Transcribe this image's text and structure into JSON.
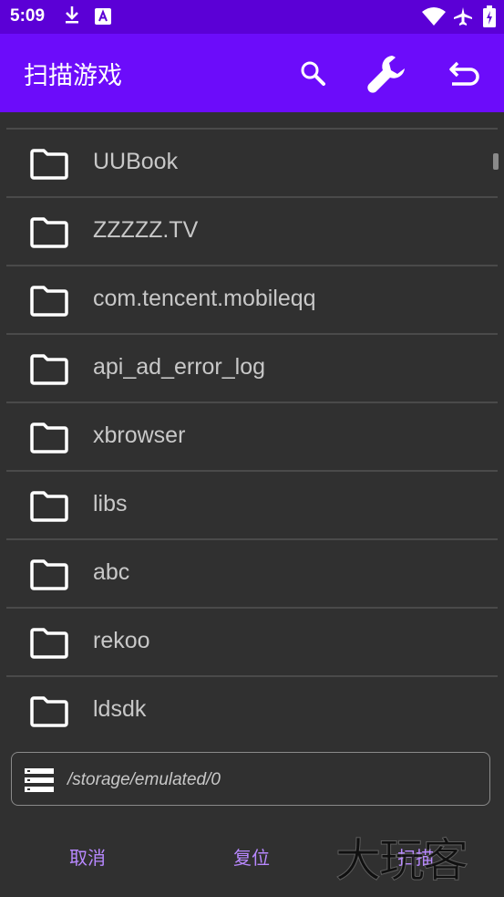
{
  "status_bar": {
    "time": "5:09",
    "icons": [
      "download-icon",
      "a-notification-icon",
      "wifi-icon",
      "airplane-mode-icon",
      "battery-icon"
    ]
  },
  "app_bar": {
    "title": "扫描游戏",
    "background_color": "#6c0cfa",
    "actions": [
      "search-icon",
      "wrench-icon",
      "undo-icon"
    ]
  },
  "folders": [
    {
      "name": "UUBook",
      "icon": "folder-icon"
    },
    {
      "name": "ZZZZZ.TV",
      "icon": "folder-icon"
    },
    {
      "name": "com.tencent.mobileqq",
      "icon": "folder-icon"
    },
    {
      "name": "api_ad_error_log",
      "icon": "folder-icon"
    },
    {
      "name": "xbrowser",
      "icon": "folder-icon"
    },
    {
      "name": "libs",
      "icon": "folder-icon"
    },
    {
      "name": "abc",
      "icon": "folder-icon"
    },
    {
      "name": "rekoo",
      "icon": "folder-icon"
    },
    {
      "name": "ldsdk",
      "icon": "folder-icon"
    }
  ],
  "path_bar": {
    "icon": "storage-icon",
    "path": "/storage/emulated/0"
  },
  "buttons": {
    "cancel": "取消",
    "reset": "复位",
    "scan": "扫描"
  },
  "watermark": "大玩客",
  "colors": {
    "accent_text": "#b888ff",
    "background": "#303030",
    "status_bar": "#5b00d6"
  }
}
